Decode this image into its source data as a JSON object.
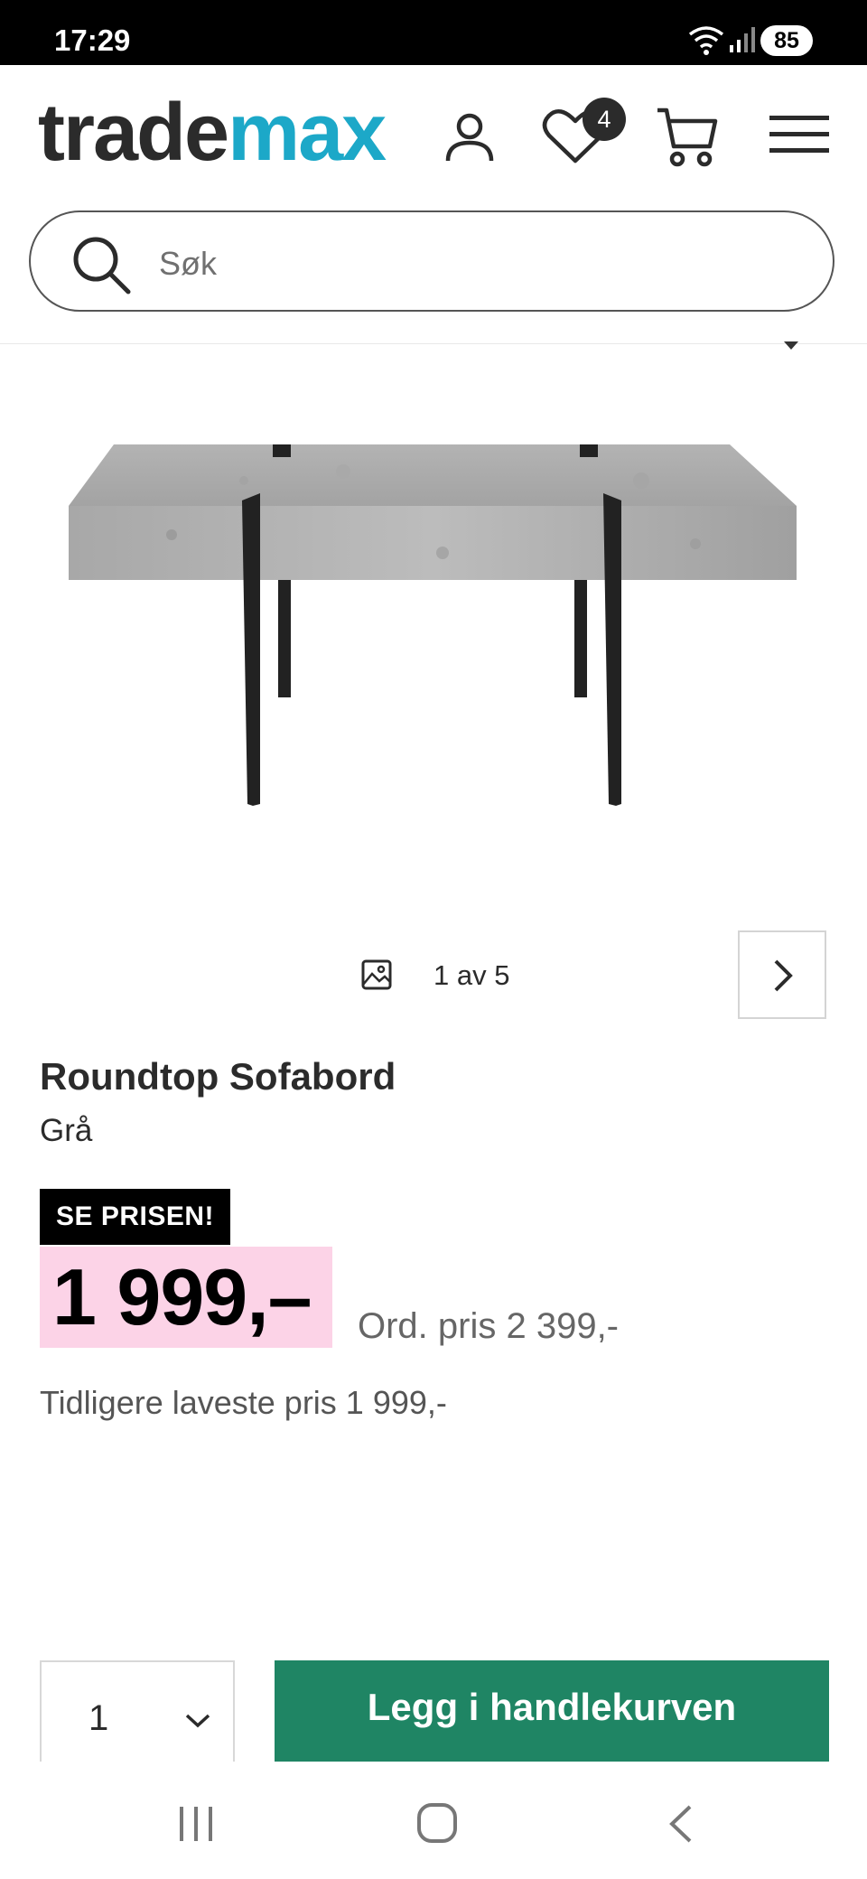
{
  "status_bar": {
    "time": "17:29",
    "battery": "85"
  },
  "header": {
    "logo_part1": "trade",
    "logo_part2": "max",
    "favorites_count": "4",
    "search_placeholder": "Søk",
    "brand_color": "#1ca8c8"
  },
  "gallery": {
    "counter": "1 av 5"
  },
  "product": {
    "title": "Roundtop Sofabord",
    "variant": "Grå",
    "promo_badge": "SE PRISEN!",
    "price": "1 999,–",
    "ordinary_price": "Ord. pris 2 399,-",
    "lowest_price": "Tidligere laveste pris 1 999,-",
    "price_highlight_color": "#fcd3e7"
  },
  "buy": {
    "quantity": "1",
    "add_to_cart_label": "Legg i handlekurven",
    "button_color": "#1f8564"
  }
}
